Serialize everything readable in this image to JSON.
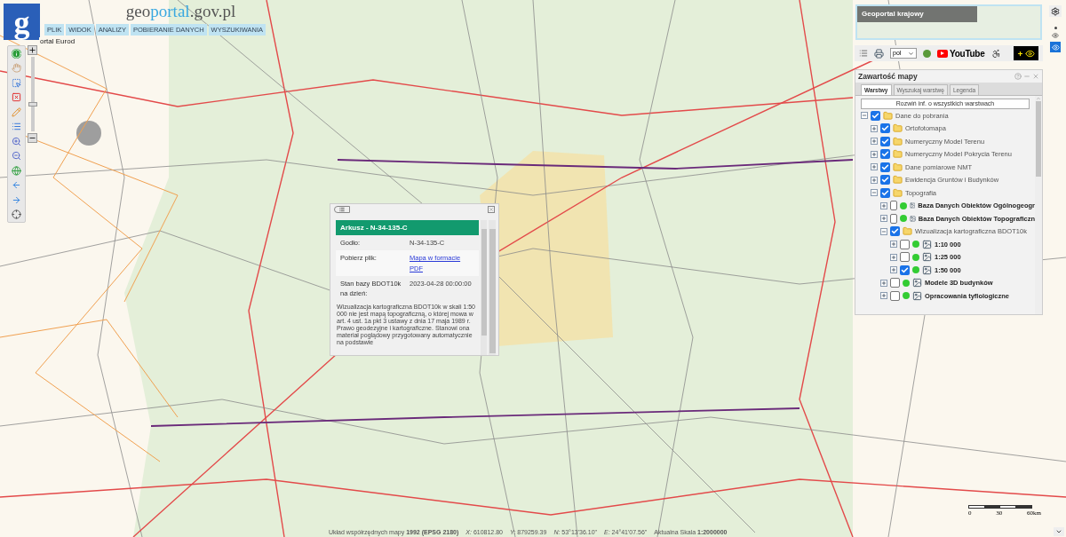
{
  "header": {
    "logo_letter": "g",
    "title_parts": [
      {
        "text": "geo",
        "kind": "plain"
      },
      {
        "text": "portal",
        "kind": "accent"
      },
      {
        "text": ".gov.pl",
        "kind": "plain"
      }
    ],
    "menu": [
      {
        "label": "PLIK"
      },
      {
        "label": "WIDOK"
      },
      {
        "label": "ANALIZY"
      },
      {
        "label": "POBIERANIE DANYCH"
      },
      {
        "label": "WYSZUKIWANIA"
      }
    ]
  },
  "map_label": "ortal Eurod",
  "zoom": {
    "level": 0.35
  },
  "overview": {
    "title": "Geoportal krajowy"
  },
  "toolbar": {
    "language": "pol",
    "youtube": "YouTube"
  },
  "layers_panel": {
    "title": "Zawartość mapy",
    "tabs": [
      {
        "label": "Warstwy",
        "selected": true
      },
      {
        "label": "Wyszukaj warstwę",
        "selected": false
      },
      {
        "label": "Legenda",
        "selected": false
      }
    ],
    "expand_button": "Rozwiń inf. o wszystkich warstwach",
    "tree": [
      {
        "label": "Dane do pobrania",
        "kind": "folder",
        "checked": true,
        "expanded": true,
        "children": [
          {
            "label": "Ortofotomapa",
            "kind": "folder",
            "checked": true,
            "expanded": false
          },
          {
            "label": "Numeryczny Model Terenu",
            "kind": "folder",
            "checked": true,
            "expanded": false
          },
          {
            "label": "Numeryczny Model Pokrycia Terenu",
            "kind": "folder",
            "checked": true,
            "expanded": false
          },
          {
            "label": "Dane pomiarowe NMT",
            "kind": "folder",
            "checked": true,
            "expanded": false
          },
          {
            "label": "Ewidencja Gruntów i Budynków",
            "kind": "folder",
            "checked": true,
            "expanded": false
          },
          {
            "label": "Topografia",
            "kind": "folder",
            "checked": true,
            "expanded": true,
            "children": [
              {
                "label": "Baza Danych Obiektów Ogólnogeogr",
                "kind": "layer",
                "checked": false,
                "expanded": false
              },
              {
                "label": "Baza Danych Obiektów Topograficzn",
                "kind": "layer",
                "checked": false,
                "expanded": false
              },
              {
                "label": "Wizualizacja kartograficzna BDOT10k",
                "kind": "folder",
                "checked": true,
                "expanded": true,
                "children": [
                  {
                    "label": "1:10 000",
                    "kind": "layer",
                    "checked": false,
                    "expanded": false
                  },
                  {
                    "label": "1:25 000",
                    "kind": "layer",
                    "checked": false,
                    "expanded": false
                  },
                  {
                    "label": "1:50 000",
                    "kind": "layer",
                    "checked": true,
                    "expanded": false
                  }
                ]
              },
              {
                "label": "Modele 3D budynków",
                "kind": "layer",
                "checked": false,
                "expanded": false
              },
              {
                "label": "Opracowania tyflologiczne",
                "kind": "layer",
                "checked": false,
                "expanded": false
              }
            ]
          }
        ]
      }
    ]
  },
  "popup": {
    "title": "Arkusz - N-34-135-C",
    "rows": [
      {
        "label": "Godło:",
        "value": "N-34-135-C",
        "kind": "text"
      },
      {
        "label": "Pobierz plik:",
        "value": "Mapa w formacie PDF",
        "kind": "link"
      },
      {
        "label": "Stan bazy BDOT10k na dzień:",
        "value": "2023-04-28 00:00:00",
        "kind": "text"
      }
    ],
    "description": "Wizualizacja kartograficzna BDOT10k w skali 1:50 000 nie jest mapą topograficzną, o której mowa w art. 4 ust. 1a pkt 3 ustawy z dnia 17 maja 1989 r. Prawo geodezyjne i kartograficzne. Stanowi ona materiał poglądowy przygotowany automatycznie na podstawie"
  },
  "scale_bar": [
    "0",
    "30",
    "60km"
  ],
  "status_bar": [
    "Układ współrzędnych mapy **1992 (EPSG 2180)**",
    "*X:* 610812.80",
    "*Y:* 879259.39",
    "*N:* 53°13'36.10\"",
    "*E:* 24°41'07.56\"",
    "Aktualna Skala **1:2000000**"
  ]
}
